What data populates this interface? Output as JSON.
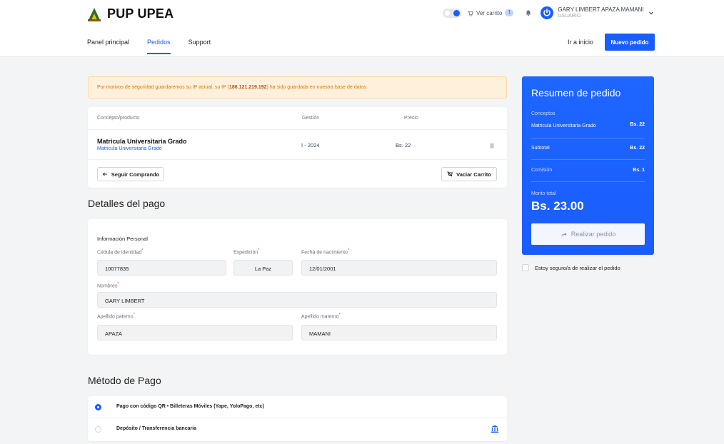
{
  "header": {
    "app_name": "PUP UPEA",
    "cart_label": "Ver carrito",
    "cart_count": "1",
    "user_name": "GARY LIMBERT APAZA MAMANI",
    "user_role": "USUARIO",
    "nav": [
      "Panel principal",
      "Pedidos",
      "Support"
    ],
    "goto_label": "Ir a inicio",
    "new_order_label": "Nuevo pedido"
  },
  "alert": {
    "prefix": "Por motivos de seguridad guardaremos su IP actual, su IP (",
    "ip": "186.121.219.192",
    "suffix": ") ha sido guardada en nuestra base de datos."
  },
  "cart": {
    "col_concept": "Concepto/producto",
    "col_gestion": "Gestión",
    "col_price": "Precio",
    "item_name": "Matricula Universitaria Grado",
    "item_sub": "Matricula Universitaria Grado",
    "item_gestion": "I - 2024",
    "item_price": "Bs. 22",
    "continue_label": "Seguir Comprando",
    "empty_label": "Vaciar Carrito"
  },
  "payment_details": {
    "title": "Detalles del pago",
    "section": "Información Personal",
    "ci_label": "Cédula de identidad",
    "ci_value": "10077835",
    "exp_label": "Expedición",
    "exp_value": "La Paz",
    "dob_label": "Fecha de nacimiento",
    "dob_value": "12/01/2001",
    "names_label": "Nombres",
    "names_value": "GARY LIMBERT",
    "paterno_label": "Apellido paterno",
    "paterno_value": "APAZA",
    "materno_label": "Apellido materno",
    "materno_value": "MAMANI"
  },
  "method": {
    "title": "Método de Pago",
    "qr_label": "Pago con código QR • Billeteras Móviles (Yape, YoloPago, etc)",
    "bank_label": "Depósito / Transferencia bancaria"
  },
  "summary": {
    "title": "Resumen de pedido",
    "concepts_label": "Conceptos",
    "concept_item": "Matricula Universitaria Grado",
    "concept_value": "Bs. 22",
    "subtotal_label": "Subtotal",
    "subtotal_value": "Bs. 22",
    "commission_label": "Comisión",
    "commission_value": "Bs. 1",
    "total_label": "Monto total",
    "total_value": "Bs. 23.00",
    "place_order_label": "Realizar pedido",
    "confirm_label": "Estoy seguro/a de realizar el pedido"
  },
  "colors": {
    "primary": "#1a5dff",
    "alert_bg": "#fff0dc",
    "alert_text": "#d97706"
  }
}
